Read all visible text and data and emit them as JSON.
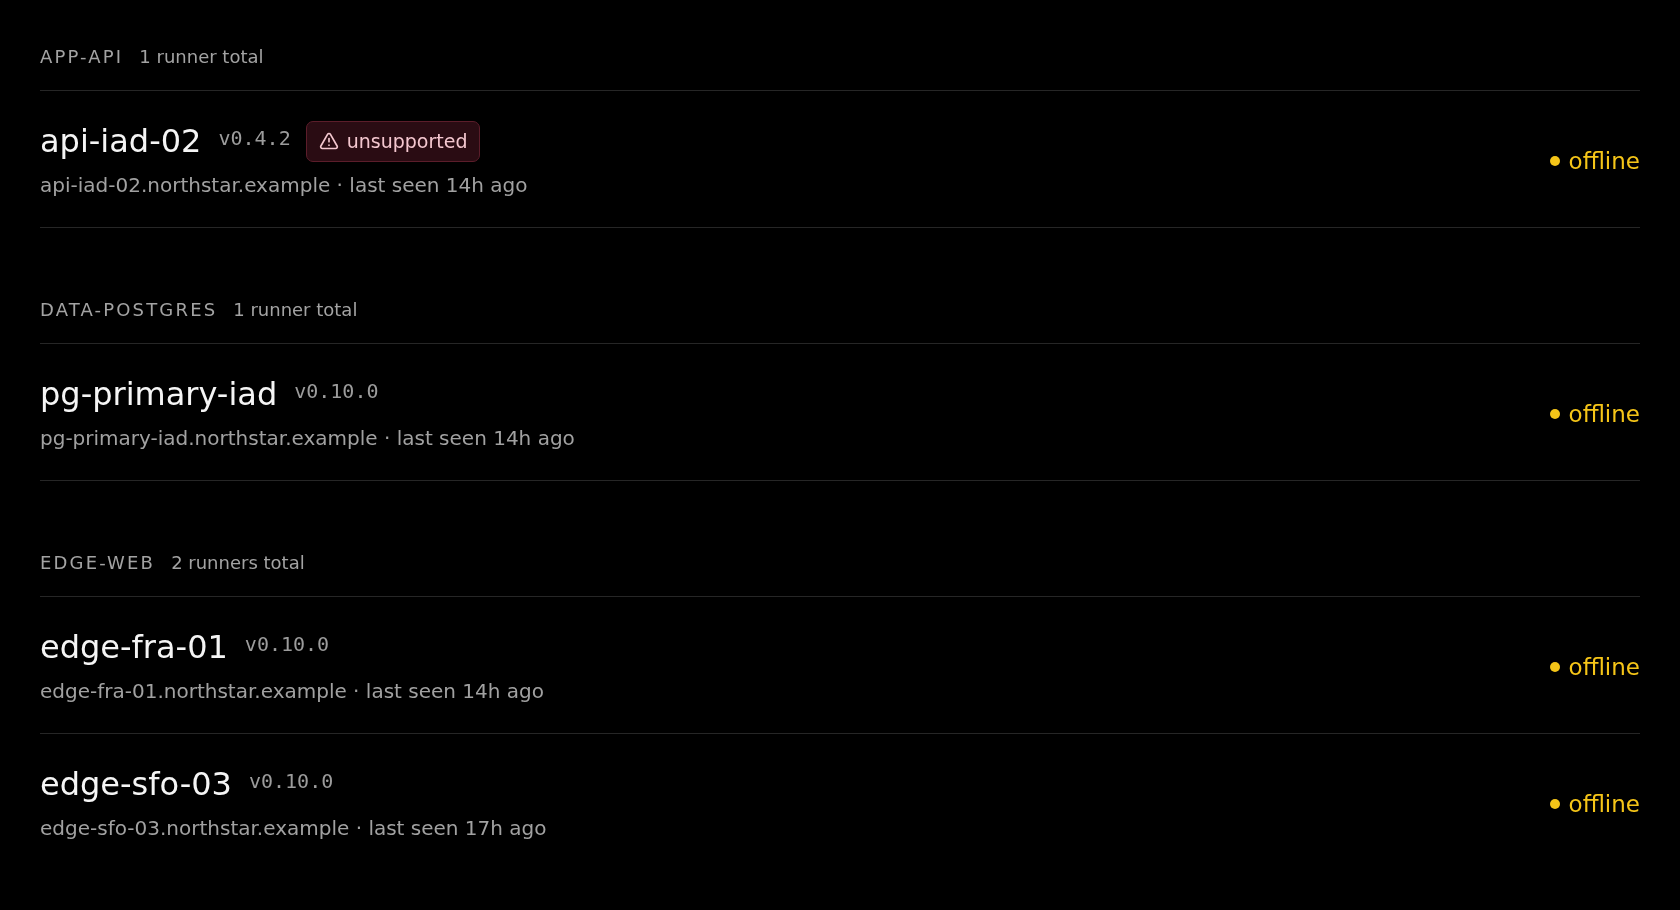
{
  "groups": [
    {
      "name": "APP-API",
      "count": "1 runner total",
      "runners": [
        {
          "name": "api-iad-02",
          "version": "v0.4.2",
          "badge": {
            "kind": "warning",
            "label": "unsupported"
          },
          "detail": "api-iad-02.northstar.example · last seen 14h ago",
          "status": {
            "label": "offline",
            "color": "#f5c518"
          }
        }
      ]
    },
    {
      "name": "DATA-POSTGRES",
      "count": "1 runner total",
      "runners": [
        {
          "name": "pg-primary-iad",
          "version": "v0.10.0",
          "detail": "pg-primary-iad.northstar.example · last seen 14h ago",
          "status": {
            "label": "offline",
            "color": "#f5c518"
          }
        }
      ]
    },
    {
      "name": "EDGE-WEB",
      "count": "2 runners total",
      "runners": [
        {
          "name": "edge-fra-01",
          "version": "v0.10.0",
          "detail": "edge-fra-01.northstar.example · last seen 14h ago",
          "status": {
            "label": "offline",
            "color": "#f5c518"
          }
        },
        {
          "name": "edge-sfo-03",
          "version": "v0.10.0",
          "detail": "edge-sfo-03.northstar.example · last seen 17h ago",
          "status": {
            "label": "offline",
            "color": "#f5c518"
          }
        }
      ]
    }
  ]
}
